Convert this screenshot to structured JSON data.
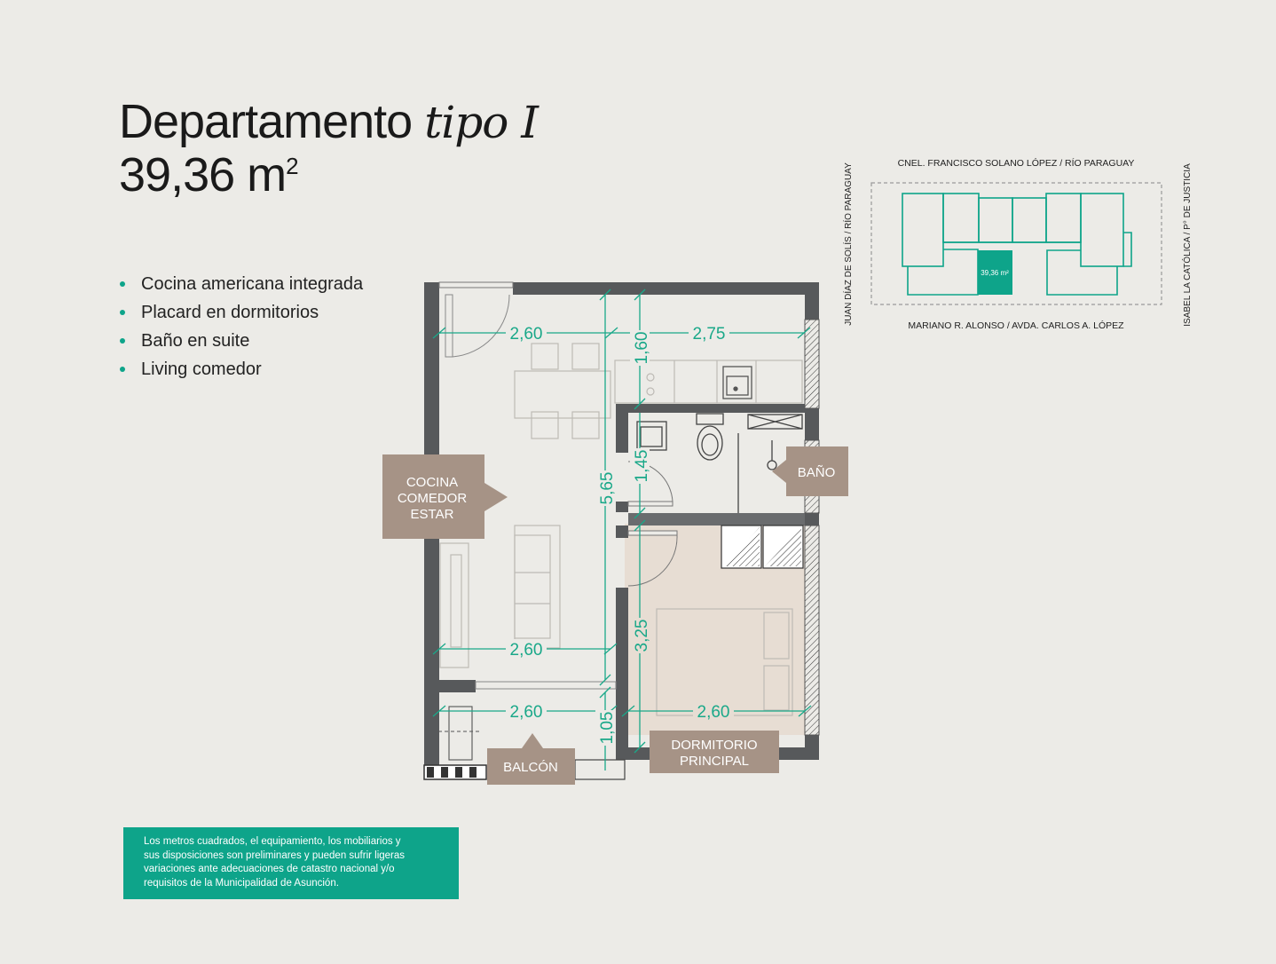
{
  "colors": {
    "accent": "#0ea48a",
    "wall": "#57595b",
    "tag": "#a69386",
    "bedroom_fill": "#e7ddd3",
    "background": "#ecebe7"
  },
  "header": {
    "title_main": "Departamento",
    "title_italic": "tipo I",
    "area_value": "39,36 m",
    "area_exp": "2"
  },
  "features": [
    "Cocina americana integrada",
    "Placard en dormitorios",
    "Baño en suite",
    "Living comedor"
  ],
  "disclaimer": [
    "Los metros cuadrados, el equipamiento, los mobiliarios y",
    "sus disposiciones son preliminares y pueden sufrir ligeras",
    "variaciones ante adecuaciones de catastro nacional y/o",
    "requisitos de la Municipalidad de Asunción."
  ],
  "keyplan": {
    "top_street": "CNEL. FRANCISCO SOLANO LÓPEZ / RÍO PARAGUAY",
    "bottom_street": "MARIANO R. ALONSO / AVDA. CARLOS A. LÓPEZ",
    "left_street": "JUAN DÍAZ DE SOLÍS / RÍO PARAGUAY",
    "right_street": "ISABEL LA CATÓLICA / P° DE JUSTICIA",
    "unit_area": "39,36 m²"
  },
  "rooms": {
    "cocina": [
      "COCINA",
      "COMEDOR",
      "ESTAR"
    ],
    "bano": "BAÑO",
    "dormitorio": [
      "DORMITORIO",
      "PRINCIPAL"
    ],
    "balcon": "BALCÓN"
  },
  "dimensions": {
    "living_width_top": "2,60",
    "kitchen_width": "2,75",
    "kitchen_depth": "1,60",
    "bath_depth": "1,45",
    "total_depth": "5,65",
    "bedroom_depth": "3,25",
    "living_width_bottom": "2,60",
    "balcony_width": "2,60",
    "balcony_depth": "1,05",
    "bedroom_width": "2,60"
  }
}
